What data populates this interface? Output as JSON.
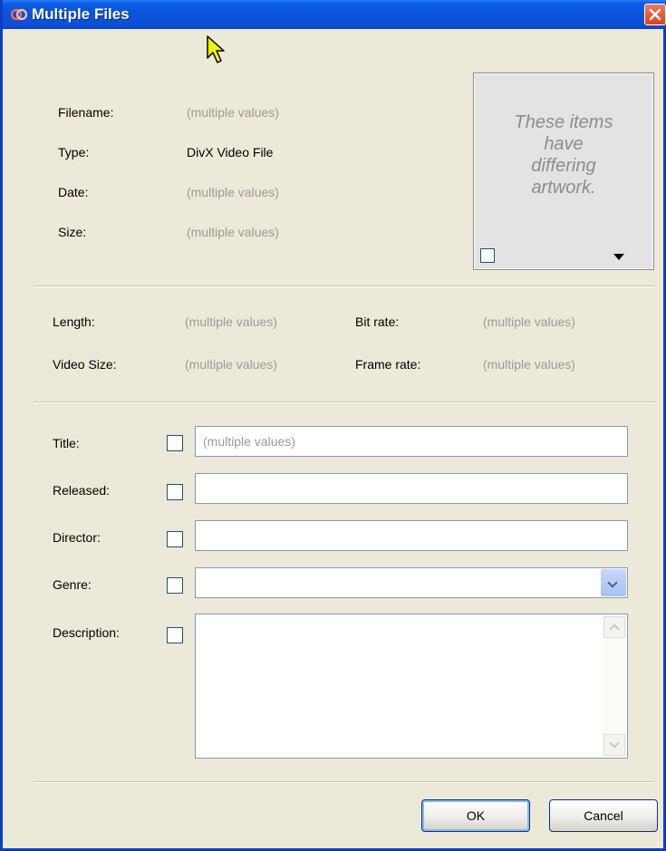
{
  "window": {
    "title": "Multiple Files"
  },
  "file_info": {
    "filename_label": "Filename:",
    "filename_value": "(multiple values)",
    "type_label": "Type:",
    "type_value": "DivX Video File",
    "date_label": "Date:",
    "date_value": "(multiple values)",
    "size_label": "Size:",
    "size_value": "(multiple values)"
  },
  "artwork": {
    "text_lines": [
      "These items",
      "have",
      "differing",
      "artwork."
    ]
  },
  "video_info": {
    "length_label": "Length:",
    "length_value": "(multiple values)",
    "bitrate_label": "Bit rate:",
    "bitrate_value": "(multiple values)",
    "videosize_label": "Video Size:",
    "videosize_value": "(multiple values)",
    "framerate_label": "Frame rate:",
    "framerate_value": "(multiple values)"
  },
  "edit": {
    "title_label": "Title:",
    "title_placeholder": "(multiple values)",
    "released_label": "Released:",
    "released_value": "",
    "director_label": "Director:",
    "director_value": "",
    "genre_label": "Genre:",
    "genre_value": "",
    "description_label": "Description:",
    "description_value": ""
  },
  "buttons": {
    "ok": "OK",
    "cancel": "Cancel"
  },
  "colors": {
    "titlebar": "#0b54d8",
    "dialog_bg": "#ece9d8",
    "close_button": "#d9421a",
    "muted_text": "#9a9a9a",
    "field_border": "#7f9db9"
  },
  "icons": {
    "app": "app-logo-icon",
    "close": "close-icon",
    "cursor": "mouse-pointer-icon"
  }
}
